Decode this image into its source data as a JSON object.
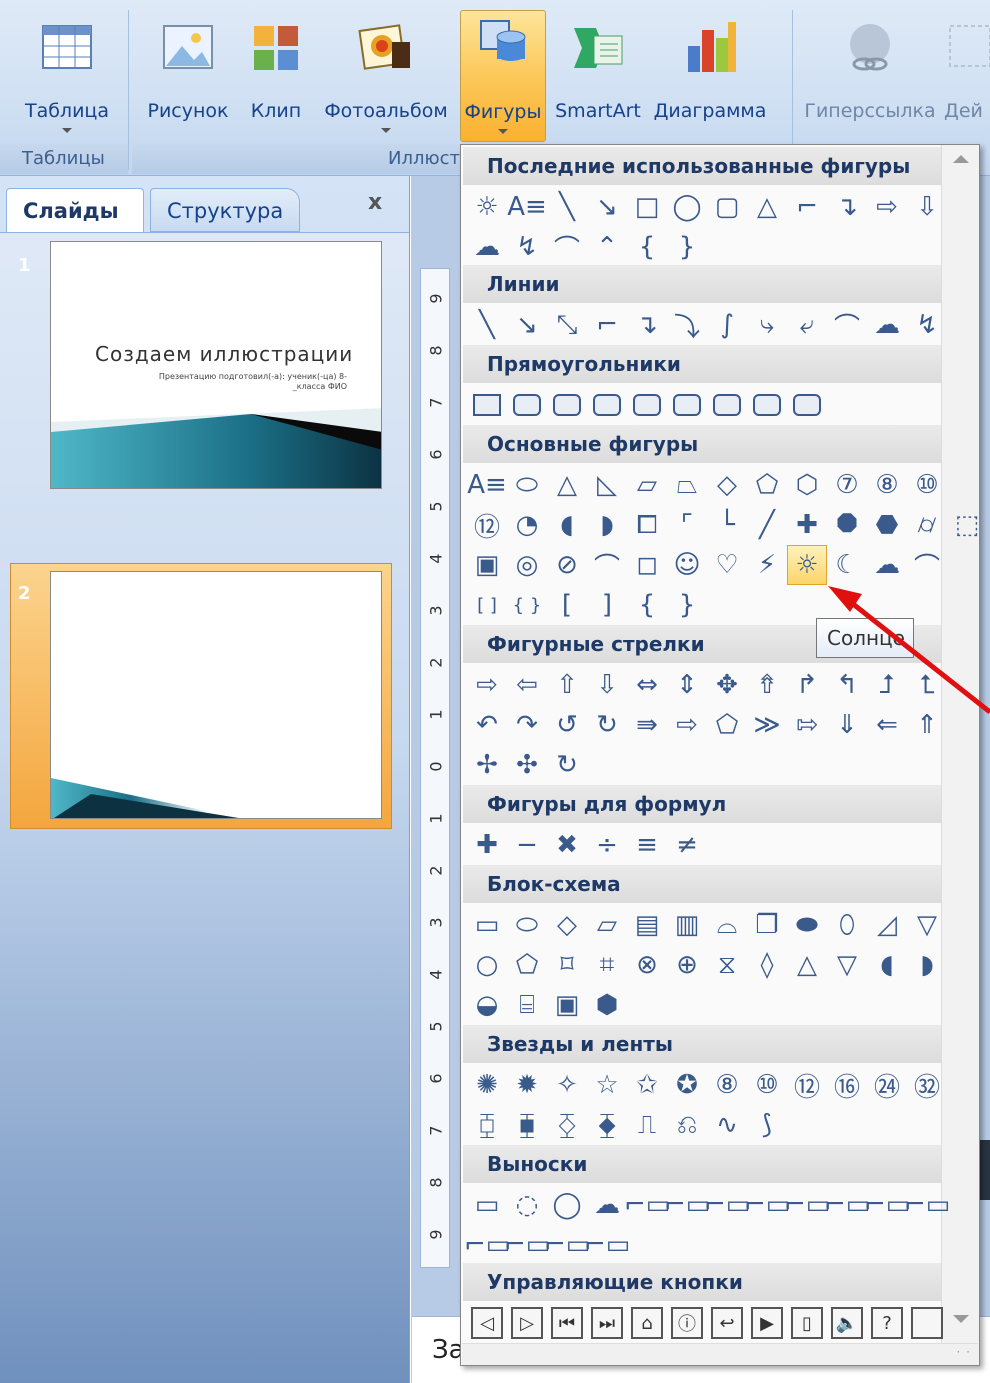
{
  "ribbon": {
    "buttons": [
      {
        "label": "Таблица",
        "icon": "table-icon"
      },
      {
        "label": "Рисунок",
        "icon": "picture-icon"
      },
      {
        "label": "Клип",
        "icon": "clipart-icon"
      },
      {
        "label": "Фотоальбом",
        "icon": "photo-album-icon"
      },
      {
        "label": "Фигуры",
        "icon": "shapes-icon"
      },
      {
        "label": "SmartArt",
        "icon": "smartart-icon"
      },
      {
        "label": "Диаграмма",
        "icon": "chart-icon"
      },
      {
        "label": "Гиперссылка",
        "icon": "hyperlink-icon"
      },
      {
        "label": "Дей",
        "icon": "action-icon"
      }
    ],
    "groups": {
      "tables": "Таблицы",
      "illustrations": "Иллюст"
    }
  },
  "panel": {
    "tab_slides": "Слайды",
    "tab_structure": "Структура",
    "close": "x"
  },
  "slides": [
    {
      "number": "1",
      "title": "Создаем иллюстрации",
      "subtitle": "Презентацию подготовил(-а): ученик(-ца) 8-_класса ФИО"
    },
    {
      "number": "2"
    }
  ],
  "ruler": {
    "ticks": [
      "9",
      "8",
      "7",
      "6",
      "5",
      "4",
      "3",
      "2",
      "1",
      "0",
      "1",
      "2",
      "3",
      "4",
      "5",
      "6",
      "7",
      "8",
      "9"
    ]
  },
  "notes": {
    "text": "За"
  },
  "menu": {
    "categories": {
      "recent": "Последние использованные фигуры",
      "lines": "Линии",
      "rectangles": "Прямоугольники",
      "basic": "Основные фигуры",
      "arrows": "Фигурные стрелки",
      "equations": "Фигуры для формул",
      "flowchart": "Блок-схема",
      "stars": "Звезды и ленты",
      "callouts": "Выноски",
      "actions": "Управляющие кнопки"
    },
    "recent_row1": [
      "☼",
      "A≡",
      "╲",
      "↘",
      "□",
      "◯",
      "▢",
      "△",
      "⌐",
      "↴",
      "⇨",
      "⇩"
    ],
    "recent_row2": [
      "☁",
      "↯",
      "⌒",
      "⌃",
      "{",
      "}"
    ],
    "lines_row": [
      "╲",
      "↘",
      "⤡",
      "⌐",
      "↴",
      "⤵",
      "∫",
      "⤷",
      "⤶",
      "⌒",
      "☁",
      "↯"
    ],
    "basic_row1": [
      "A≡",
      "⬭",
      "△",
      "◺",
      "▱",
      "⏢",
      "◇",
      "⬠",
      "⬡",
      "⑦",
      "⑧",
      "⑩"
    ],
    "basic_row2": [
      "⑫",
      "◔",
      "◖",
      "◗",
      "⧠",
      "⌜",
      "└",
      "╱",
      "✚",
      "⯃",
      "⬣",
      "⌭",
      "⬚"
    ],
    "basic_row3": [
      "▣",
      "◎",
      "⊘",
      "⌒",
      "◻",
      "☺",
      "♡",
      "⚡",
      "☼",
      "☾",
      "☁",
      "⌒"
    ],
    "basic_row4": [
      "[ ]",
      "{ }",
      "[",
      "]",
      "{",
      "}"
    ],
    "arrows_row1": [
      "⇨",
      "⇦",
      "⇧",
      "⇩",
      "⇔",
      "⇕",
      "✥",
      "⇮",
      "↱",
      "↰",
      "⮥",
      "⮤"
    ],
    "arrows_row2": [
      "↶",
      "↷",
      "↺",
      "↻",
      "⇛",
      "⇨",
      "⬠",
      "≫",
      "⇰",
      "⇓",
      "⇐",
      "⇑"
    ],
    "arrows_row3": [
      "✢",
      "✣",
      "↻"
    ],
    "equations_row": [
      "✚",
      "−",
      "✖",
      "÷",
      "≡",
      "≠"
    ],
    "flow_row1": [
      "▭",
      "⬭",
      "◇",
      "▱",
      "▤",
      "▥",
      "⌓",
      "❐",
      "⬬",
      "⬯",
      "◿",
      "▽"
    ],
    "flow_row2": [
      "○",
      "⬠",
      "⌑",
      "⌗",
      "⊗",
      "⊕",
      "⧖",
      "◊",
      "△",
      "▽",
      "◖",
      "◗"
    ],
    "flow_row3": [
      "◒",
      "⌸",
      "▣",
      "⬢"
    ],
    "stars_row1": [
      "✺",
      "✹",
      "✧",
      "☆",
      "✩",
      "✪",
      "⑧",
      "⑩",
      "⑫",
      "⑯",
      "㉔",
      "㉜"
    ],
    "stars_row2": [
      "⧮",
      "⧯",
      "⧰",
      "⧱",
      "⎍",
      "⎌",
      "∿",
      "⟆"
    ],
    "callouts_row1": [
      "▭",
      "◌",
      "◯",
      "☁",
      "⌐▭",
      "⌐▭",
      "⌐▭",
      "⌐▭",
      "⌐▭",
      "⌐▭",
      "⌐▭",
      "⌐▭"
    ],
    "callouts_row2": [
      "⌐▭",
      "⌐▭",
      "⌐▭",
      "⌐▭"
    ],
    "actions_row": [
      "◁",
      "▷",
      "⏮",
      "⏭",
      "⌂",
      "ⓘ",
      "↩",
      "▶",
      "▯",
      "🔈",
      "?",
      ""
    ]
  },
  "tooltip": {
    "text": "Солнце"
  },
  "colors": {
    "accent": "#f9b131",
    "arrow": "#e01010",
    "ribbon_text": "#15428b"
  }
}
